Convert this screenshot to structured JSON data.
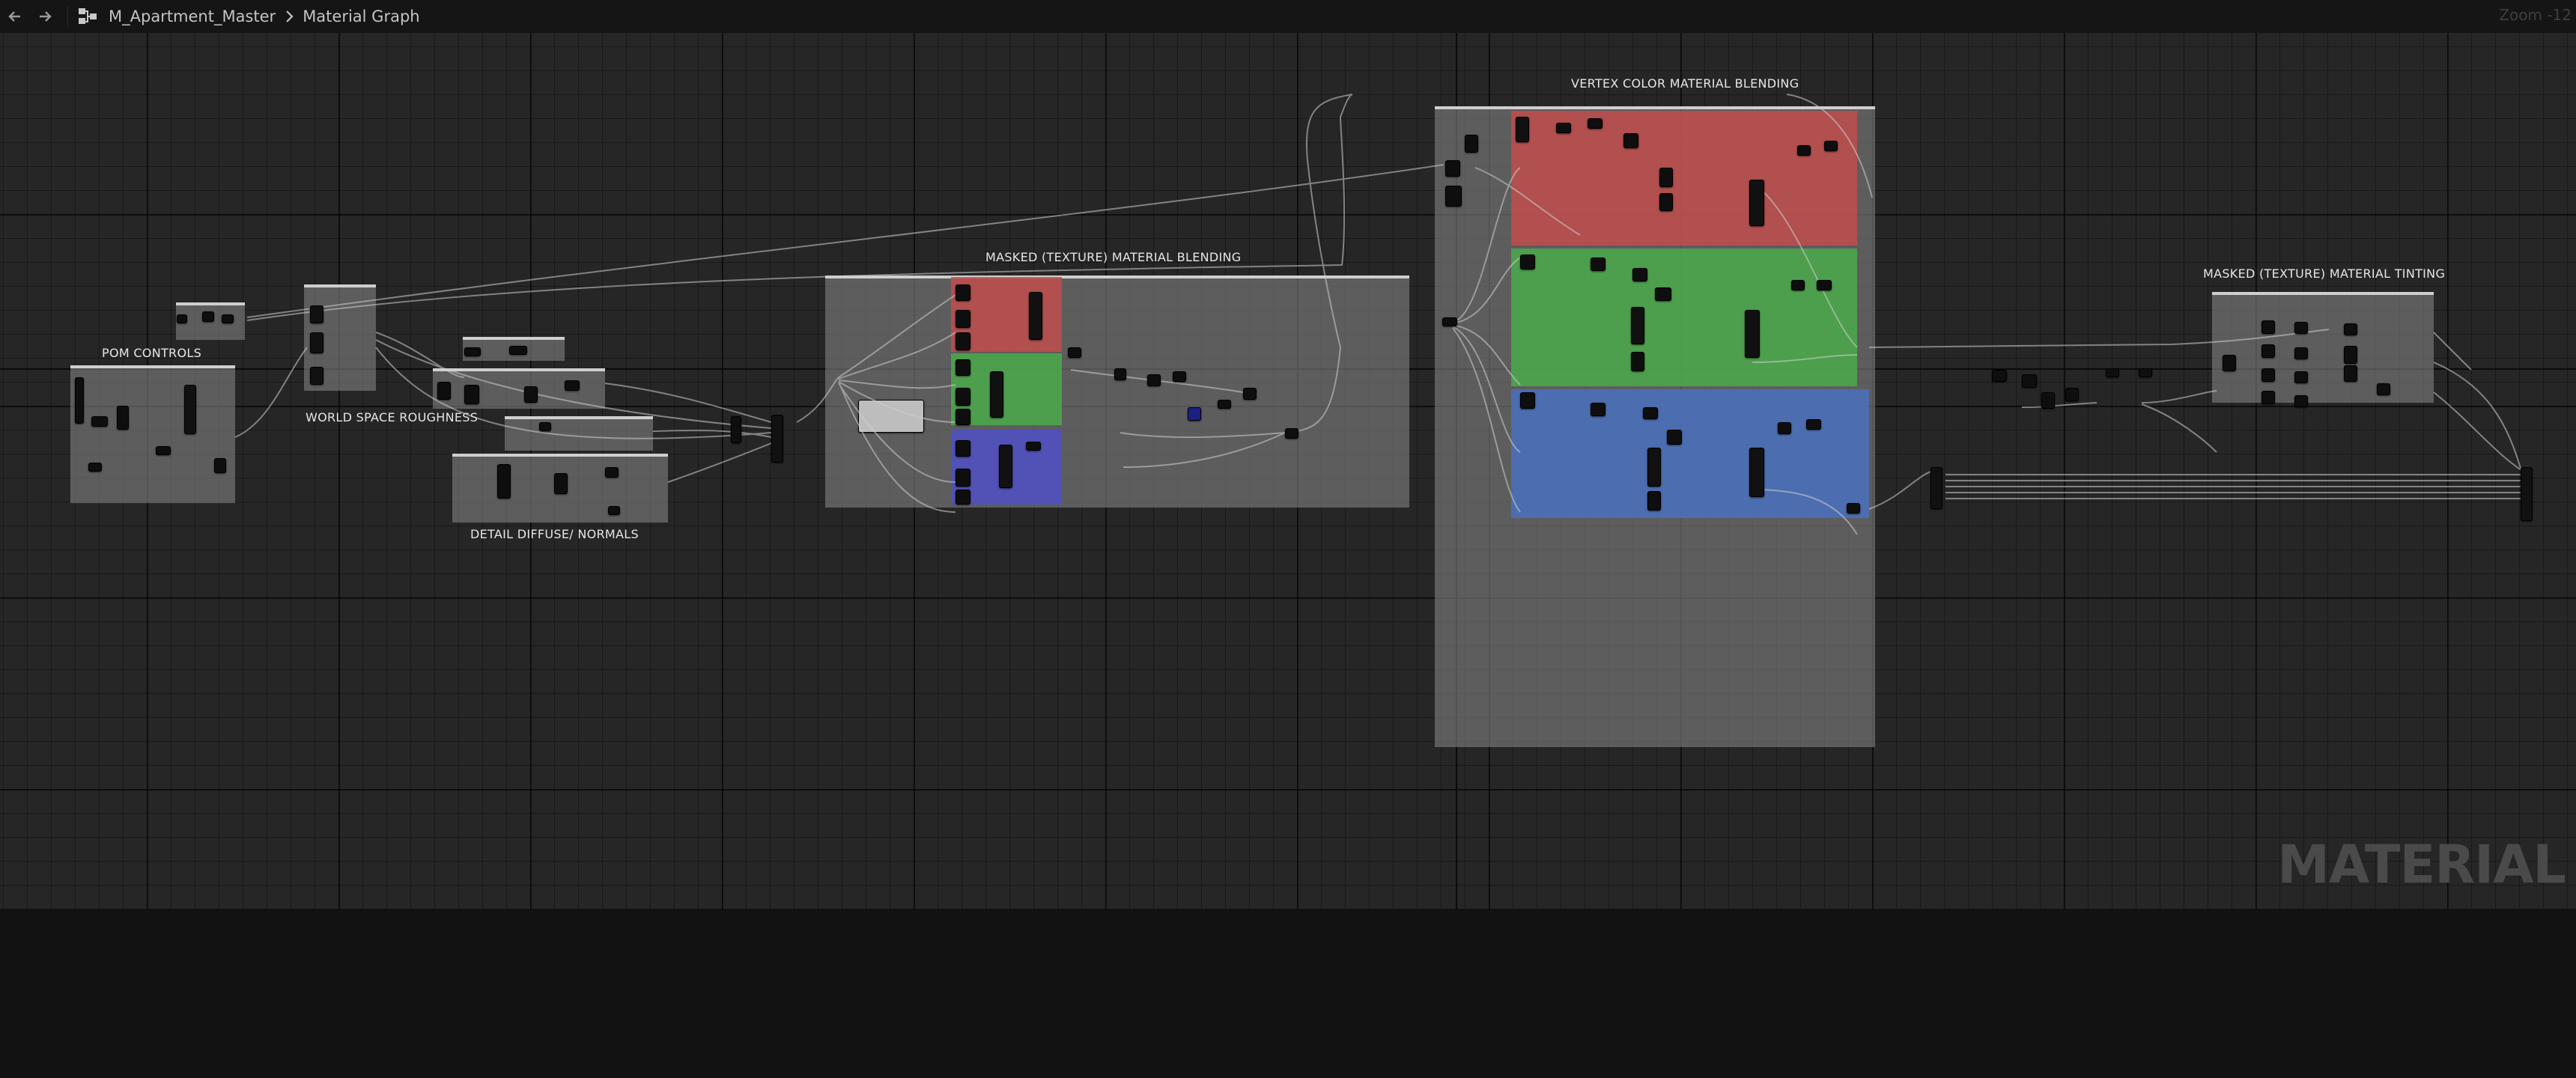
{
  "toolbar": {
    "back_icon": "arrow-left-icon",
    "forward_icon": "arrow-right-icon",
    "graph_icon": "graph-icon",
    "breadcrumb": [
      "M_Apartment_Master",
      "Material Graph"
    ],
    "zoom_label": "Zoom -12"
  },
  "canvas": {
    "comments": {
      "pom_controls": "POM CONTROLS",
      "world_space_roughness": "WORLD SPACE ROUGHNESS",
      "detail_diffuse_normals": "DETAIL DIFFUSE/ NORMALS",
      "masked_material_blending": "MASKED (TEXTURE) MATERIAL BLENDING",
      "vertex_color_material_blending": "VERTEX COLOR MATERIAL BLENDING",
      "masked_material_tinting": "MASKED (TEXTURE) MATERIAL TINTING"
    },
    "region_colors": {
      "red": "#c14c4c",
      "green": "#4aaa4a",
      "blue": "#4a6fb8",
      "purple": "#5050c0"
    },
    "watermark": "MATERIAL"
  }
}
